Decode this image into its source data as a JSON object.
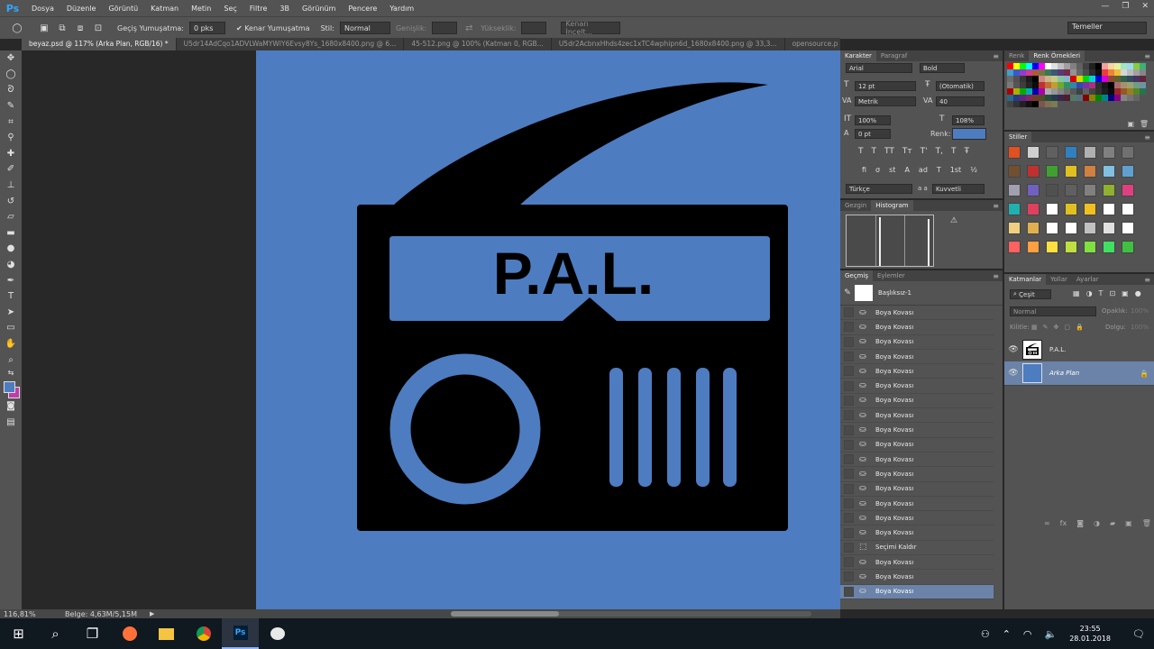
{
  "app": {
    "logo": "Ps"
  },
  "menu": [
    "Dosya",
    "Düzenle",
    "Görüntü",
    "Katman",
    "Metin",
    "Seç",
    "Filtre",
    "3B",
    "Görünüm",
    "Pencere",
    "Yardım"
  ],
  "window_controls": [
    "—",
    "❐",
    "✕"
  ],
  "options": {
    "feather_label": "Geçiş Yumuşatma:",
    "feather_value": "0 pks",
    "antialias_label": "Kenar Yumuşatma",
    "style_label": "Stil:",
    "style_value": "Normal",
    "width_label": "Genişlik:",
    "height_label": "Yükseklik:",
    "refine_label": "Kenarı İncelt...",
    "workspace": "Temeller"
  },
  "tabs": [
    {
      "label": "beyaz.psd @ 117% (Arka Plan, RGB/16) *"
    },
    {
      "label": "U5dr14AdCqo1ADVLWaMYWIY6Evsy8Ys_1680x8400.png @ 6..."
    },
    {
      "label": "45-512.png @ 100% (Katman 0, RGB..."
    },
    {
      "label": "U5dr2AcbnxHhds4zec1xTC4wphipn6d_1680x8400.png @ 33,3..."
    },
    {
      "label": "opensource.p"
    }
  ],
  "canvas": {
    "bg_color": "#4d7cc1",
    "logo_text": "P.A.L."
  },
  "status": {
    "zoom": "116,81%",
    "doc": "Belge: 4,63M/5,15M"
  },
  "character": {
    "tabs": [
      "Karakter",
      "Paragraf"
    ],
    "font": "Arial",
    "weight": "Bold",
    "size": "12 pt",
    "leading": "(Otomatik)",
    "kerning": "Metrik",
    "tracking": "40",
    "vscale": "100%",
    "hscale": "108%",
    "baseline": "0 pt",
    "color_label": "Renk:",
    "color": "#4d7cc1",
    "type_buttons": [
      "T",
      "T",
      "TT",
      "Tт",
      "T'",
      "T,",
      "T",
      "Ŧ"
    ],
    "ot_buttons": [
      "fi",
      "σ",
      "st",
      "A",
      "ad",
      "T",
      "1st",
      "½"
    ],
    "language": "Türkçe",
    "aa_label": "a a",
    "aa_value": "Kuvvetli"
  },
  "navigator": {
    "tabs": [
      "Gezgin",
      "Histogram"
    ]
  },
  "history": {
    "tabs": [
      "Geçmiş",
      "Eylemler"
    ],
    "snapshot": "Başlıksız-1",
    "items": [
      "Boya Kovası",
      "Boya Kovası",
      "Boya Kovası",
      "Boya Kovası",
      "Boya Kovası",
      "Boya Kovası",
      "Boya Kovası",
      "Boya Kovası",
      "Boya Kovası",
      "Boya Kovası",
      "Boya Kovası",
      "Boya Kovası",
      "Boya Kovası",
      "Boya Kovası",
      "Boya Kovası",
      "Boya Kovası",
      "Seçimi Kaldır",
      "Boya Kovası",
      "Boya Kovası",
      "Boya Kovası"
    ],
    "selected_index": 19
  },
  "swatches": {
    "tabs": [
      "Renk",
      "Renk Örnekleri"
    ]
  },
  "styles": {
    "tab": "Stiller"
  },
  "layers": {
    "tabs": [
      "Katmanlar",
      "Yollar",
      "Ayarlar"
    ],
    "filter": "Çeşit",
    "blend": "Normal",
    "opacity_label": "Opaklık:",
    "opacity": "100%",
    "lock_label": "Kilitle:",
    "fill_label": "Dolgu:",
    "fill": "100%",
    "items": [
      {
        "name": "P.A.L."
      },
      {
        "name": "Arka Plan"
      }
    ]
  },
  "taskbar": {
    "time": "23:55",
    "date": "28.01.2018"
  }
}
